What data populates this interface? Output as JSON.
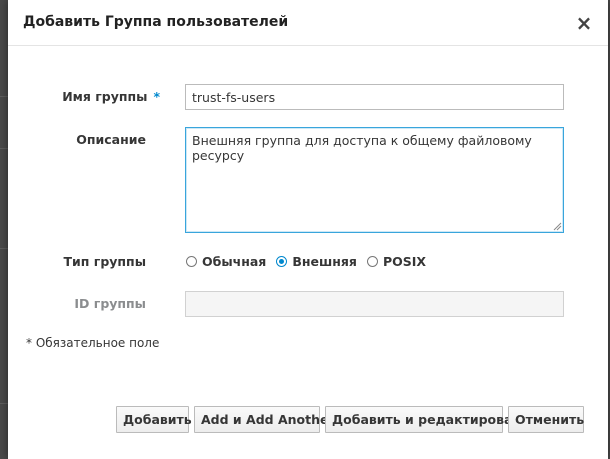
{
  "dialog": {
    "title": "Добавить Группа пользователей",
    "close_icon": "×"
  },
  "form": {
    "group_name": {
      "label": "Имя группы",
      "required_mark": "*",
      "value": "trust-fs-users"
    },
    "description": {
      "label": "Описание",
      "value": "Внешняя группа для доступа к общему файловому ресурсу"
    },
    "group_type": {
      "label": "Тип группы",
      "options": [
        {
          "label": "Обычная",
          "checked": false
        },
        {
          "label": "Внешняя",
          "checked": true
        },
        {
          "label": "POSIX",
          "checked": false
        }
      ]
    },
    "group_id": {
      "label": "ID группы",
      "value": "",
      "disabled": true
    },
    "required_note": "* Обязательное поле"
  },
  "footer": {
    "add": "Добавить",
    "add_another": "Add и Add Another",
    "add_and_edit": "Добавить и редактировать",
    "cancel": "Отменить"
  },
  "colors": {
    "accent": "#0088ce",
    "focus_border": "#39a5dc",
    "backdrop": "#4a4a4a"
  }
}
